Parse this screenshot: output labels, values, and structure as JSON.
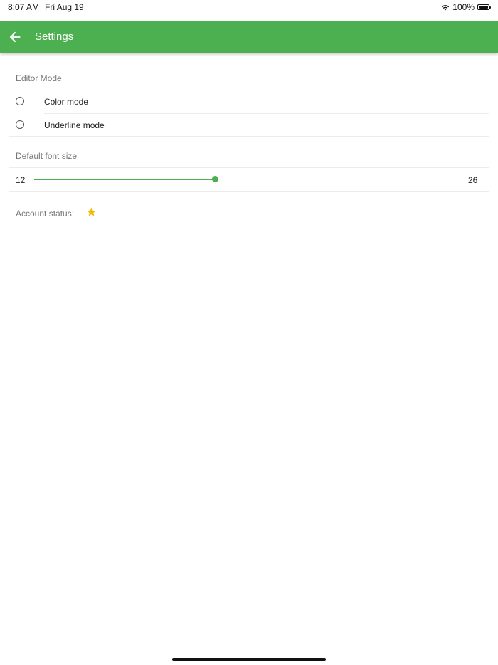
{
  "status_bar": {
    "time": "8:07 AM",
    "date": "Fri Aug 19",
    "battery_text": "100%",
    "wifi_icon": "wifi-icon",
    "battery_icon": "battery-icon"
  },
  "app_bar": {
    "title": "Settings",
    "back_icon": "arrow-left-icon",
    "color": "#4caf50"
  },
  "editor_mode": {
    "label": "Editor Mode",
    "options": [
      {
        "label": "Color mode",
        "selected": false
      },
      {
        "label": "Underline mode",
        "selected": false
      }
    ]
  },
  "font_size": {
    "label": "Default font size",
    "min_label": "12",
    "max_label": "26",
    "min": 12,
    "max": 26,
    "value": 18
  },
  "account": {
    "label": "Account status:",
    "status_icon": "star-icon",
    "star_color": "#f5b800"
  },
  "colors": {
    "accent": "#4caf50",
    "text_primary": "#222222",
    "text_secondary": "#777777"
  }
}
